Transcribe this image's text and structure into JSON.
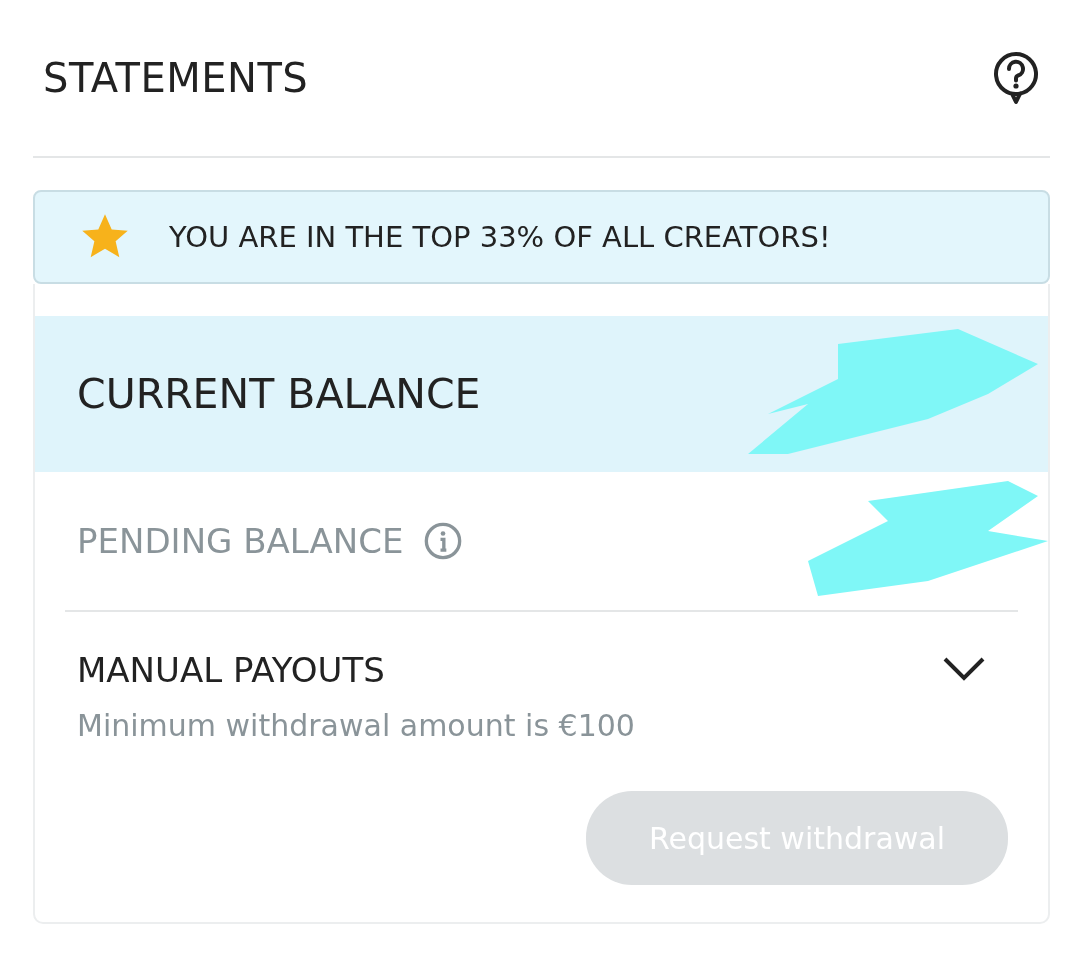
{
  "header": {
    "title": "STATEMENTS"
  },
  "banner": {
    "text": "YOU ARE IN THE TOP 33% OF ALL CREATORS!"
  },
  "balances": [
    {
      "kind": "current",
      "label": "CURRENT BALANCE",
      "redacted": true
    },
    {
      "kind": "pending",
      "label": "PENDING BALANCE",
      "redacted": true
    }
  ],
  "payouts": {
    "title": "MANUAL PAYOUTS",
    "note": "Minimum withdrawal amount is €100",
    "button": {
      "label": "Request withdrawal",
      "disabled": true
    }
  }
}
